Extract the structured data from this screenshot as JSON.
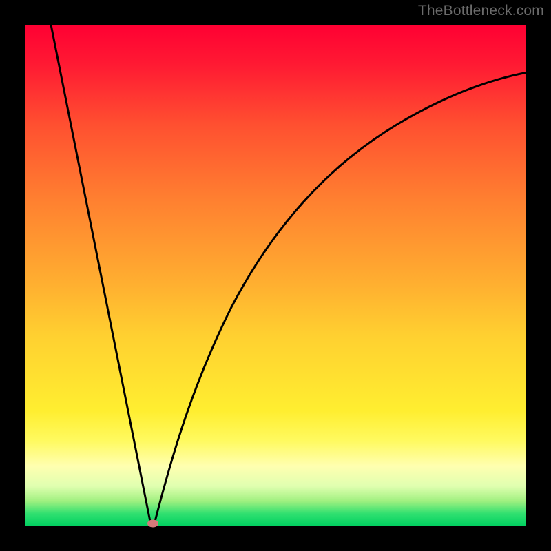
{
  "watermark": "TheBottleneck.com",
  "chart_data": {
    "type": "line",
    "title": "",
    "xlabel": "",
    "ylabel": "",
    "xlim": [
      0,
      100
    ],
    "ylim": [
      0,
      100
    ],
    "grid": false,
    "legend": false,
    "curve": {
      "left_branch": {
        "x_start": 5,
        "y_start": 100,
        "x_end": 25,
        "y_end": 0
      },
      "right_branch": {
        "x": [
          25,
          28,
          31,
          35,
          40,
          46,
          53,
          61,
          70,
          80,
          90,
          100
        ],
        "y": [
          0,
          12,
          23,
          35,
          47,
          57,
          66,
          73,
          79,
          83,
          86,
          88
        ]
      },
      "minimum_at": {
        "x": 25,
        "y": 0
      }
    },
    "marker": {
      "x": 25.5,
      "y": 0.7,
      "color": "#d47a7a"
    },
    "background_gradient": {
      "type": "vertical",
      "stops": [
        {
          "pos": 0.0,
          "color": "#ff0033"
        },
        {
          "pos": 0.5,
          "color": "#ffc030"
        },
        {
          "pos": 0.85,
          "color": "#ffff90"
        },
        {
          "pos": 1.0,
          "color": "#00d060"
        }
      ]
    }
  }
}
